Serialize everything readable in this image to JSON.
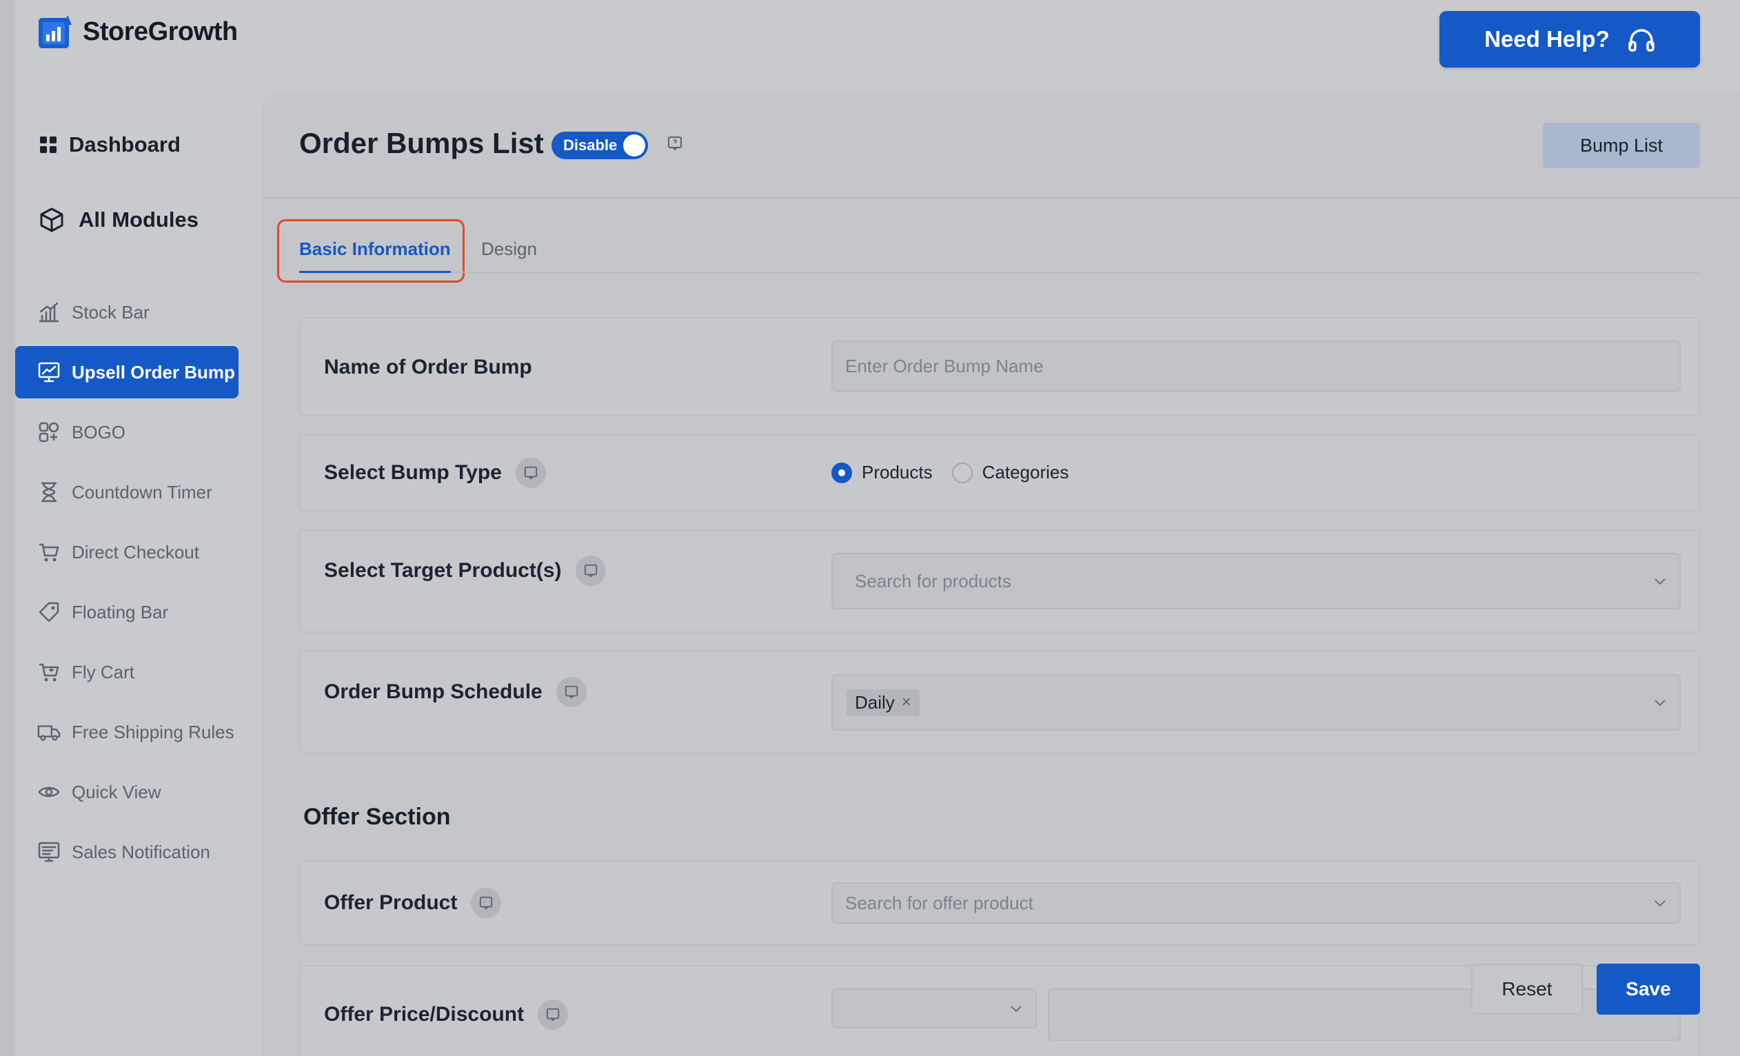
{
  "app": {
    "name": "StoreGrowth"
  },
  "header": {
    "help_label": "Need Help?"
  },
  "sidebar": {
    "main": [
      {
        "label": "Dashboard",
        "icon": "grid-icon"
      },
      {
        "label": "All Modules",
        "icon": "cube-icon"
      }
    ],
    "items": [
      {
        "label": "Stock Bar",
        "icon": "bar-chart-icon",
        "active": false
      },
      {
        "label": "Upsell Order Bump",
        "icon": "trend-monitor-icon",
        "active": true
      },
      {
        "label": "BOGO",
        "icon": "bogo-icon",
        "active": false
      },
      {
        "label": "Countdown Timer",
        "icon": "hourglass-icon",
        "active": false
      },
      {
        "label": "Direct Checkout",
        "icon": "cart-icon",
        "active": false
      },
      {
        "label": "Floating Bar",
        "icon": "tag-icon",
        "active": false
      },
      {
        "label": "Fly Cart",
        "icon": "cart-icon",
        "active": false
      },
      {
        "label": "Free Shipping Rules",
        "icon": "truck-icon",
        "active": false
      },
      {
        "label": "Quick View",
        "icon": "eye-icon",
        "active": false
      },
      {
        "label": "Sales Notification",
        "icon": "notification-icon",
        "active": false
      }
    ]
  },
  "page": {
    "title": "Order Bumps List",
    "toggle_label": "Disable",
    "bump_list_label": "Bump List",
    "tabs": [
      {
        "label": "Basic Information",
        "active": true
      },
      {
        "label": "Design",
        "active": false
      }
    ]
  },
  "form": {
    "name": {
      "label": "Name of Order Bump",
      "placeholder": "Enter Order Bump Name",
      "value": ""
    },
    "bump_type": {
      "label": "Select Bump Type",
      "options": [
        "Products",
        "Categories"
      ],
      "selected": "Products"
    },
    "target": {
      "label": "Select Target Product(s)",
      "placeholder": "Search for products"
    },
    "schedule": {
      "label": "Order Bump Schedule",
      "chip": "Daily",
      "chip_remove": "×"
    },
    "offer_section_title": "Offer Section",
    "offer_product": {
      "label": "Offer Product",
      "placeholder": "Search for offer product"
    },
    "offer_price": {
      "label": "Offer Price/Discount"
    }
  },
  "actions": {
    "reset_label": "Reset",
    "save_label": "Save"
  },
  "colors": {
    "primary": "#1459c6",
    "highlight": "#e04a2a",
    "background": "#c9cacd"
  }
}
